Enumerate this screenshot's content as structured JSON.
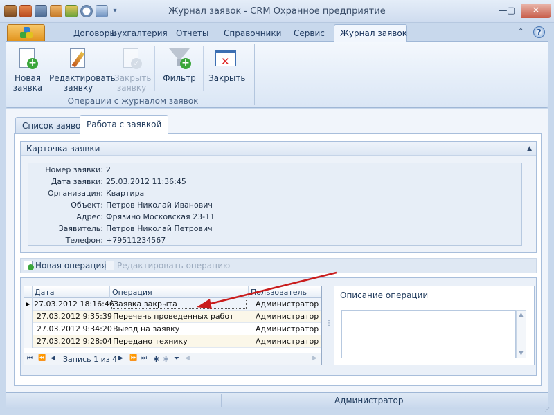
{
  "window": {
    "title": "Журнал заявок - CRM Охранное предприятие",
    "controls": [
      "minimize-icon",
      "maximize-icon",
      "close-icon"
    ]
  },
  "quick_access": [
    "app-icon",
    "briefcase-icon",
    "calculator-icon",
    "handshake-icon",
    "user-icon",
    "clock-icon",
    "screen-icon"
  ],
  "ribbon": {
    "tabs": [
      {
        "label": "Договоры"
      },
      {
        "label": "Бухгалтерия"
      },
      {
        "label": "Отчеты"
      },
      {
        "label": "Справочники"
      },
      {
        "label": "Сервис"
      },
      {
        "label": "Журнал заявок",
        "active": true
      }
    ],
    "buttons": {
      "new": {
        "line1": "Новая",
        "line2": "заявка"
      },
      "edit": {
        "line1": "Редактировать",
        "line2": "заявку"
      },
      "close_request": {
        "line1": "Закрыть",
        "line2": "заявку",
        "disabled": true
      },
      "filter": {
        "line1": "Фильтр"
      },
      "close": {
        "line1": "Закрыть"
      }
    },
    "group_label": "Операции с журналом заявок"
  },
  "page_tabs": [
    {
      "label": "Список заявок"
    },
    {
      "label": "Работа с заявкой",
      "active": true
    }
  ],
  "card": {
    "title": "Карточка заявки",
    "fields": [
      {
        "label": "Номер заявки:",
        "value": "2"
      },
      {
        "label": "Дата заявки:",
        "value": "25.03.2012 11:36:45"
      },
      {
        "label": "Организация:",
        "value": "Квартира"
      },
      {
        "label": "Объект:",
        "value": "Петров Николай Иванович"
      },
      {
        "label": "Адрес:",
        "value": "Фрязино Московская 23-11"
      },
      {
        "label": "Заявитель:",
        "value": "Петров Николай Петрович"
      },
      {
        "label": "Телефон:",
        "value": "+79511234567"
      }
    ]
  },
  "op_toolbar": {
    "new_label": "Новая операция",
    "edit_label": "Редактировать операцию"
  },
  "grid": {
    "columns": [
      "Дата",
      "Операция",
      "Пользователь"
    ],
    "rows": [
      {
        "date": "27.03.2012 18:16:46",
        "operation": "Заявка закрыта",
        "user": "Администратор"
      },
      {
        "date": "27.03.2012 9:35:39",
        "operation": "Перечень проведенных работ",
        "user": "Администратор"
      },
      {
        "date": "27.03.2012 9:34:20",
        "operation": "Выезд на заявку",
        "user": "Администратор"
      },
      {
        "date": "27.03.2012 9:28:04",
        "operation": "Передано технику",
        "user": "Администратор"
      }
    ],
    "navigator": {
      "record_text": "Запись 1 из 4"
    }
  },
  "description": {
    "title": "Описание операции"
  },
  "status": {
    "user": "Администратор"
  },
  "colors": {
    "accent": "#c91c1c",
    "file_tab": "#e9a22e",
    "ribbon_bg": "#dae6f5"
  }
}
